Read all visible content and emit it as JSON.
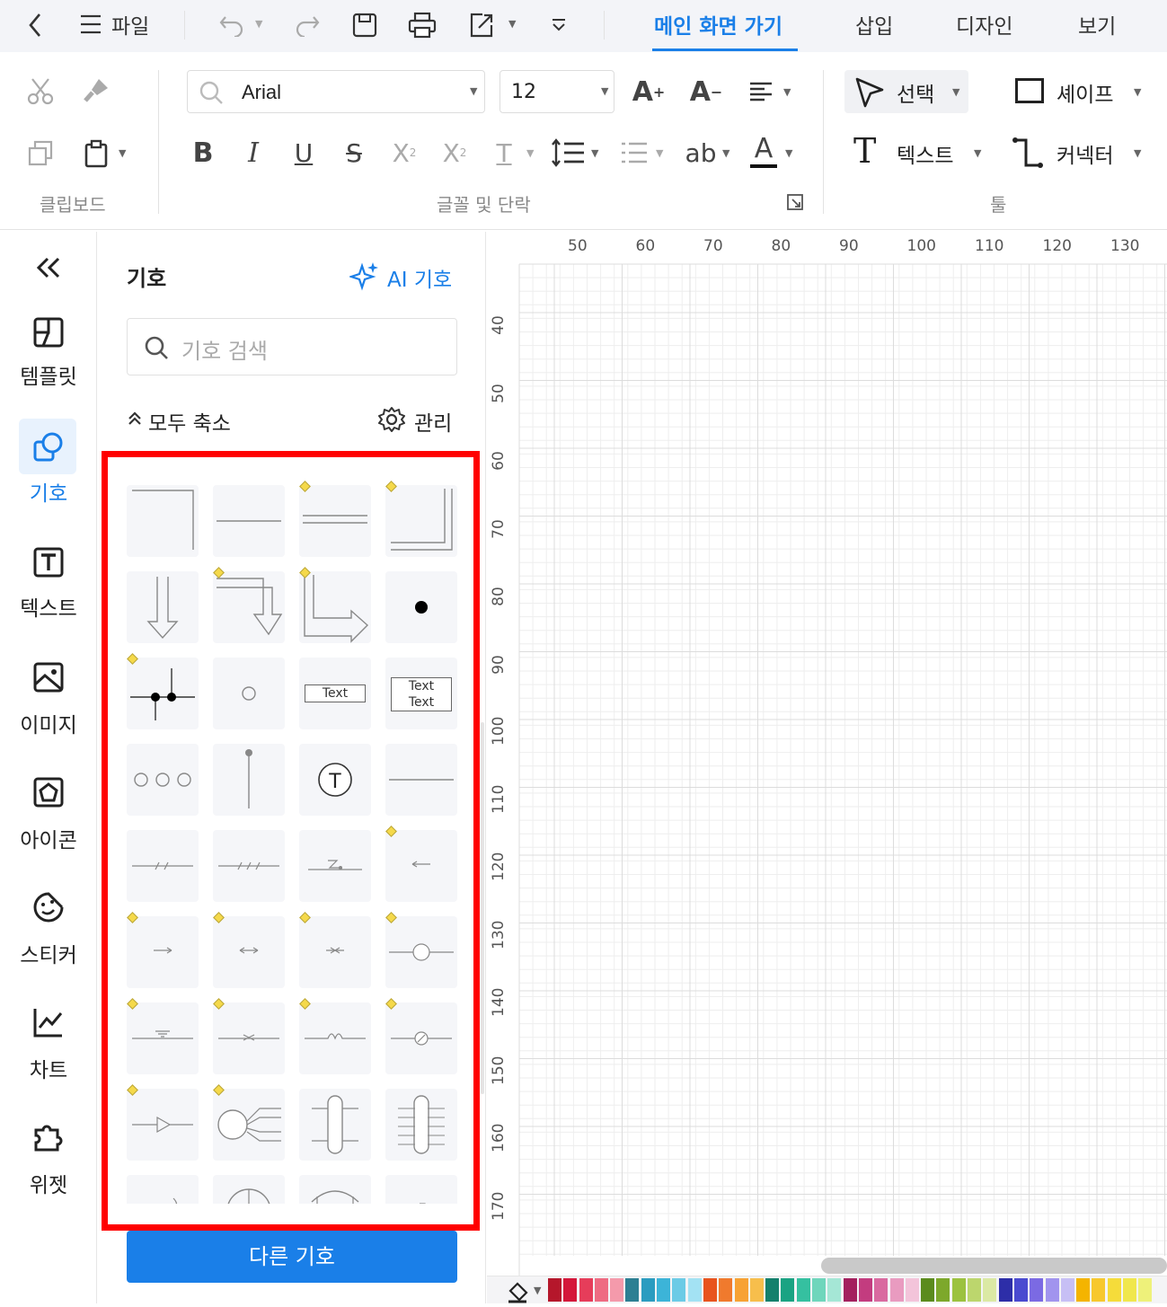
{
  "menubar": {
    "file_label": "파일",
    "tabs": [
      {
        "label": "메인 화면 가기",
        "active": true
      },
      {
        "label": "삽입",
        "active": false
      },
      {
        "label": "디자인",
        "active": false
      },
      {
        "label": "보기",
        "active": false
      }
    ]
  },
  "ribbon": {
    "font_family": "Arial",
    "font_size": "12",
    "select_label": "선택",
    "shape_label": "셰이프",
    "text_label": "텍스트",
    "connector_label": "커넥터",
    "group_clipboard": "클립보드",
    "group_font": "글꼴 및 단락",
    "group_tools": "툴"
  },
  "leftnav": {
    "items": [
      {
        "label": "템플릿",
        "icon": "template-icon",
        "active": false
      },
      {
        "label": "기호",
        "icon": "symbol-icon",
        "active": true
      },
      {
        "label": "텍스트",
        "icon": "text-icon",
        "active": false
      },
      {
        "label": "이미지",
        "icon": "image-icon",
        "active": false
      },
      {
        "label": "아이콘",
        "icon": "icon-icon",
        "active": false
      },
      {
        "label": "스티커",
        "icon": "sticker-icon",
        "active": false
      },
      {
        "label": "차트",
        "icon": "chart-icon",
        "active": false
      },
      {
        "label": "위젯",
        "icon": "widget-icon",
        "active": false
      }
    ]
  },
  "panel": {
    "title": "기호",
    "ai_label": "AI 기호",
    "search_placeholder": "기호 검색",
    "collapse_label": "모두 축소",
    "manage_label": "관리",
    "more_button": "다른 기호",
    "tile_text_single": "Text",
    "tile_text_double_1": "Text",
    "tile_text_double_2": "Text",
    "tile_t_symbol": "T"
  },
  "ruler": {
    "top": [
      "50",
      "60",
      "70",
      "80",
      "90",
      "100",
      "110",
      "120",
      "130"
    ],
    "left": [
      "40",
      "50",
      "60",
      "70",
      "80",
      "90",
      "100",
      "110",
      "120",
      "130",
      "140",
      "150",
      "160",
      "170"
    ]
  },
  "colors": {
    "accent": "#1a7fe8",
    "highlight": "#ff0000",
    "palette": [
      "#b5172b",
      "#d4173a",
      "#e63d5a",
      "#ee6b82",
      "#f49aab",
      "#2d7f93",
      "#2b9cc0",
      "#3cb4d8",
      "#6ccbe6",
      "#a3e2f3",
      "#e8541e",
      "#f07a2d",
      "#f7a234",
      "#f7be4c",
      "#14806c",
      "#1aa383",
      "#35c0a0",
      "#6fd6bc",
      "#a5e7d6",
      "#a3205e",
      "#c33c7f",
      "#d96aa0",
      "#e99bc0",
      "#f3c4da",
      "#5b8b1d",
      "#7da82b",
      "#9cc23f",
      "#bcd66d",
      "#dbe9a4",
      "#2d2ea8",
      "#4a4ad0",
      "#7b6ae3",
      "#a194ee",
      "#c7bff5",
      "#f4b400",
      "#f7c82d",
      "#f5dc3a",
      "#f0e74d",
      "#eef17a"
    ]
  }
}
